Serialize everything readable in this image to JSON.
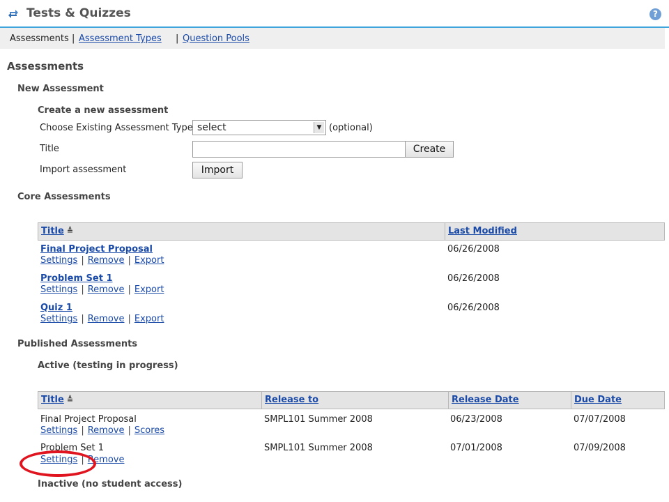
{
  "header": {
    "title": "Tests & Quizzes",
    "help": "?"
  },
  "nav": {
    "current": "Assessments",
    "sep1": "|",
    "types_link": "Assessment Types",
    "sep2": "|",
    "pools_link": "Question Pools"
  },
  "page_title": "Assessments",
  "new_assessment": {
    "heading": "New Assessment",
    "subheading": "Create a new assessment",
    "type_label": "Choose Existing Assessment Type",
    "type_value": "select",
    "optional": "(optional)",
    "title_label": "Title",
    "title_value": "",
    "create_label": "Create",
    "import_label": "Import assessment",
    "import_button": "Import"
  },
  "core": {
    "heading": "Core Assessments",
    "headers": {
      "title": "Title",
      "last_modified": "Last Modified"
    },
    "rows": [
      {
        "title": "Final Project Proposal",
        "modified": "06/26/2008",
        "actions": [
          "Settings",
          "Remove",
          "Export"
        ]
      },
      {
        "title": "Problem Set 1",
        "modified": "06/26/2008",
        "actions": [
          "Settings",
          "Remove",
          "Export"
        ]
      },
      {
        "title": "Quiz 1",
        "modified": "06/26/2008",
        "actions": [
          "Settings",
          "Remove",
          "Export"
        ]
      }
    ]
  },
  "published": {
    "heading": "Published Assessments",
    "active_heading": "Active (testing in progress)",
    "headers": {
      "title": "Title",
      "release_to": "Release to",
      "release_date": "Release Date",
      "due_date": "Due Date"
    },
    "rows": [
      {
        "title": "Final Project Proposal",
        "release_to": "SMPL101 Summer 2008",
        "release_date": "06/23/2008",
        "due_date": "07/07/2008",
        "actions": [
          "Settings",
          "Remove",
          "Scores"
        ]
      },
      {
        "title": "Problem Set 1",
        "release_to": "SMPL101 Summer 2008",
        "release_date": "07/01/2008",
        "due_date": "07/09/2008",
        "actions": [
          "Settings",
          "Remove"
        ]
      }
    ],
    "inactive_heading": "Inactive (no student access)"
  },
  "colors": {
    "link": "#1a4aa8",
    "header_rule": "#3fa4dc",
    "highlight": "#e0141e"
  },
  "icons": {
    "tool": "reload-arrows-icon",
    "help": "help-circle-icon",
    "sort": "sort-ascending-icon"
  }
}
